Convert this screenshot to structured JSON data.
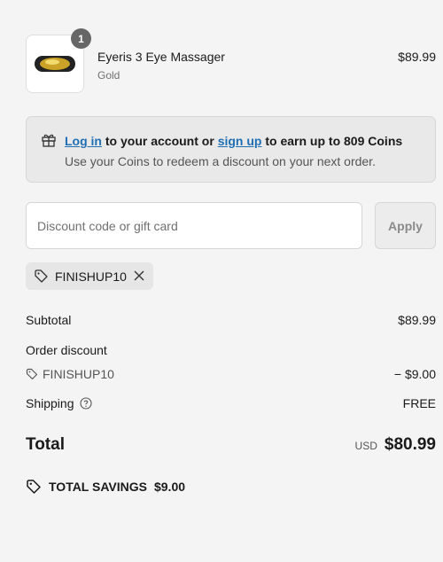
{
  "product": {
    "quantity": "1",
    "name": "Eyeris 3 Eye Massager",
    "variant": "Gold",
    "price": "$89.99"
  },
  "banner": {
    "login_link": "Log in",
    "text_mid": " to your account or ",
    "signup_link": "sign up",
    "text_end": " to earn up to 809 Coins",
    "subtext": "Use your Coins to redeem a discount on your next order."
  },
  "discount": {
    "placeholder": "Discount code or gift card",
    "apply_label": "Apply",
    "applied_code": "FINISHUP10"
  },
  "summary": {
    "subtotal_label": "Subtotal",
    "subtotal_value": "$89.99",
    "order_discount_label": "Order discount",
    "discount_code": "FINISHUP10",
    "discount_value": "− $9.00",
    "shipping_label": "Shipping",
    "shipping_value": "FREE",
    "total_label": "Total",
    "currency": "USD",
    "total_value": "$80.99",
    "savings_label": "TOTAL SAVINGS",
    "savings_value": "$9.00"
  }
}
